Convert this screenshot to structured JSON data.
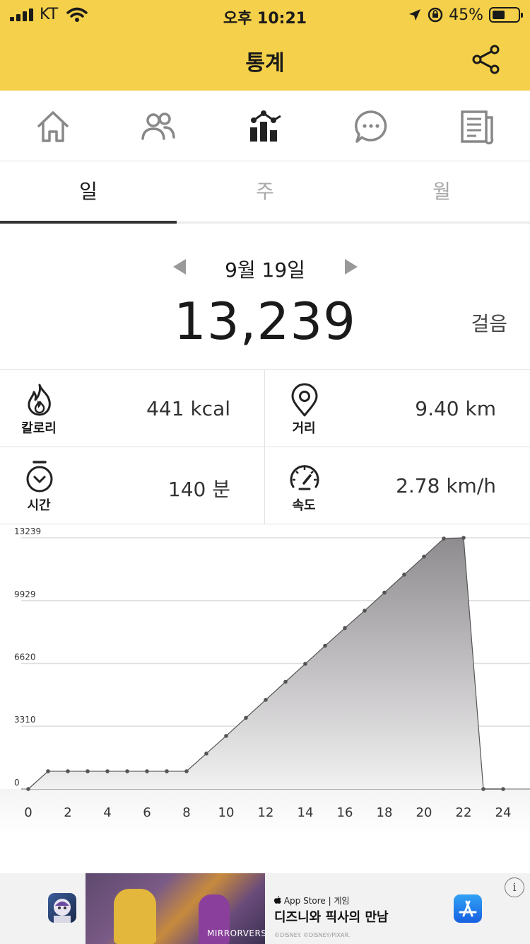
{
  "status_bar": {
    "carrier": "KT",
    "time": "오후 10:21",
    "battery": "45%",
    "battery_level": 0.45
  },
  "app_bar": {
    "title": "통계",
    "share_icon": "share-icon"
  },
  "nav": {
    "items": [
      {
        "icon": "home-icon"
      },
      {
        "icon": "friends-icon"
      },
      {
        "icon": "stats-icon",
        "active": true
      },
      {
        "icon": "chat-icon"
      },
      {
        "icon": "news-icon"
      }
    ]
  },
  "tabs": [
    {
      "label": "일",
      "active": true
    },
    {
      "label": "주",
      "active": false
    },
    {
      "label": "월",
      "active": false
    }
  ],
  "summary": {
    "date": "9월 19일",
    "steps": "13,239",
    "steps_unit": "걸음"
  },
  "stats": {
    "calories": {
      "label": "칼로리",
      "value": "441 kcal",
      "icon": "flame-icon"
    },
    "distance": {
      "label": "거리",
      "value": "9.40 km",
      "icon": "location-pin-icon"
    },
    "time": {
      "label": "시간",
      "value": "140 분",
      "icon": "stopwatch-icon"
    },
    "speed": {
      "label": "속도",
      "value": "2.78 km/h",
      "icon": "speedometer-icon"
    }
  },
  "chart_data": {
    "type": "area",
    "title": "",
    "xlabel": "",
    "ylabel": "",
    "x": [
      0,
      1,
      2,
      3,
      4,
      5,
      6,
      7,
      8,
      9,
      10,
      11,
      12,
      13,
      14,
      15,
      16,
      17,
      18,
      19,
      20,
      21,
      22,
      23,
      24
    ],
    "values": [
      0,
      937,
      937,
      937,
      937,
      937,
      937,
      937,
      937,
      1870,
      2800,
      3750,
      4700,
      5650,
      6600,
      7550,
      8480,
      9400,
      10350,
      11300,
      12250,
      13200,
      13239,
      0,
      0
    ],
    "x_ticks": [
      "0",
      "2",
      "4",
      "6",
      "8",
      "10",
      "12",
      "14",
      "16",
      "18",
      "20",
      "22",
      "24"
    ],
    "y_ticks": [
      "0",
      "3310",
      "6620",
      "9929",
      "13239"
    ],
    "ylim": [
      0,
      13239
    ],
    "xlim": [
      0,
      24
    ],
    "grid": true,
    "fill_color": "#b8b6b8",
    "line_color": "#555555"
  },
  "ad": {
    "source": "App Store | 게임",
    "title": "디즈니와 픽사의 만남",
    "copyright": "©DISNEY. ©DISNEY/PIXAR.",
    "banner_logo": "MIRRORVERSE",
    "info": "i"
  }
}
